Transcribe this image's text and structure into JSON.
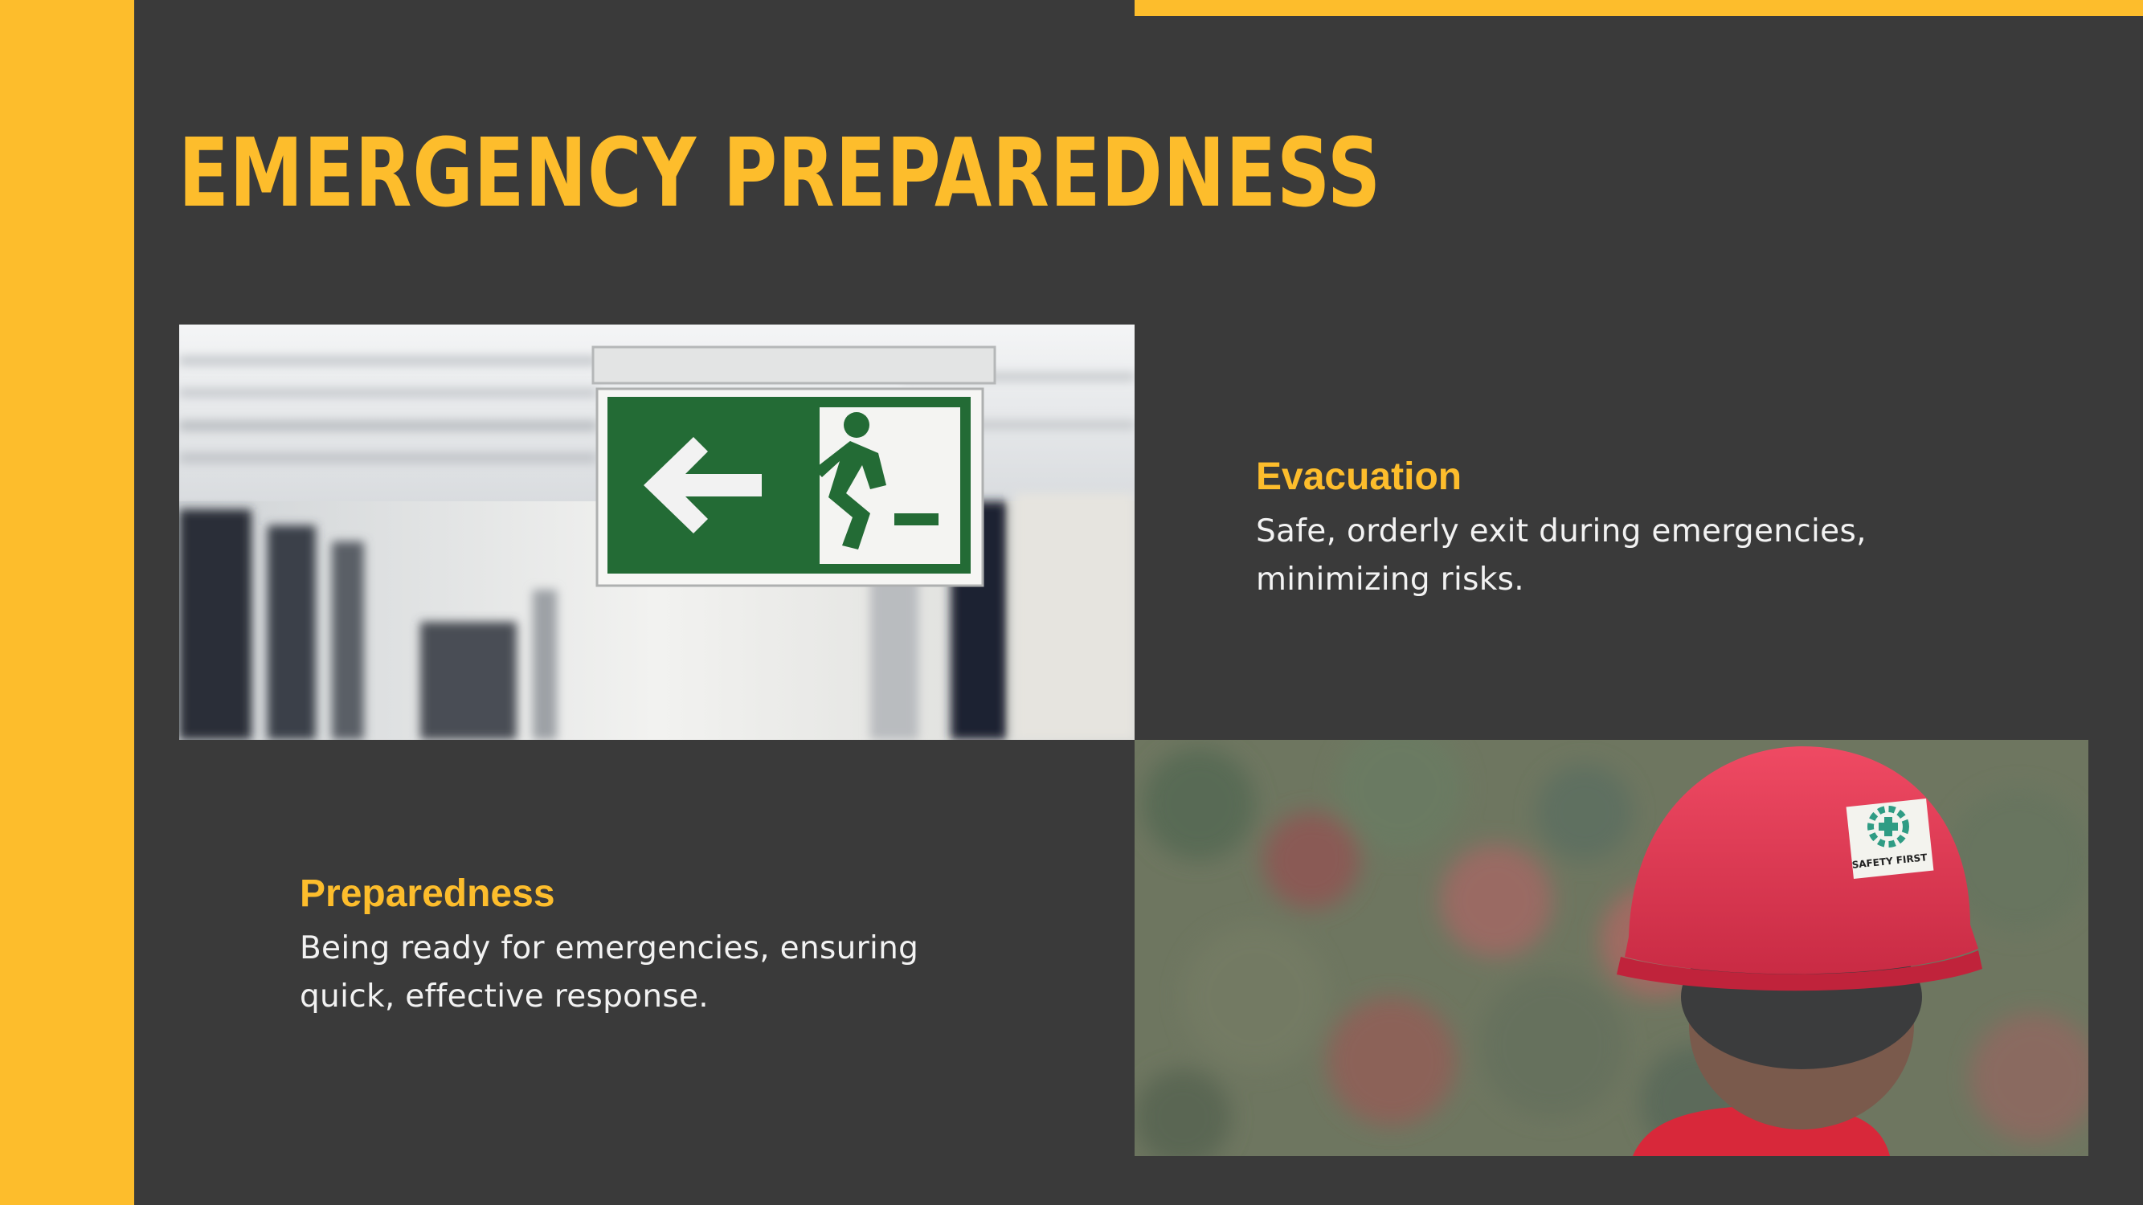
{
  "slide": {
    "title": "EMERGENCY PREPAREDNESS",
    "accent_color": "#fdbd2c",
    "background_color": "#3a3a3a"
  },
  "images": {
    "exit_sign": {
      "description_icon": "exit-sign-icon"
    },
    "helmet": {
      "sticker_text": "SAFETY FIRST"
    }
  },
  "sections": {
    "evacuation": {
      "heading": "Evacuation",
      "body": "Safe, orderly exit during emergencies, minimizing risks."
    },
    "preparedness": {
      "heading": "Preparedness",
      "body": "Being ready for emergencies, ensuring quick, effective response."
    }
  }
}
